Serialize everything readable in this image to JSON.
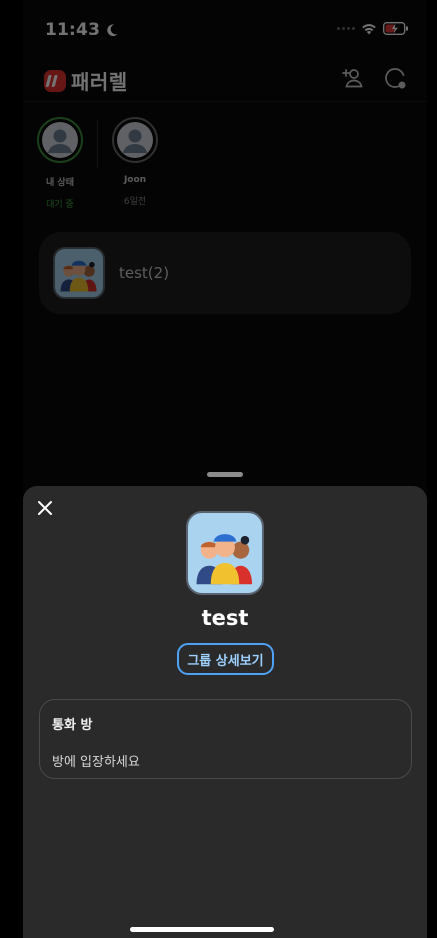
{
  "status_bar": {
    "time": "11:43"
  },
  "app": {
    "name": "패러렐"
  },
  "people": [
    {
      "name": "내 상태",
      "status": "대기 중",
      "active": true
    },
    {
      "name": "Joon",
      "status": "6일전",
      "active": false
    }
  ],
  "groups": [
    {
      "name": "test(2)"
    }
  ],
  "sheet": {
    "title": "test",
    "detail_button": "그룹 상세보기",
    "call_room": {
      "title": "통화 방",
      "description": "방에 입장하세요"
    }
  },
  "colors": {
    "accent_blue": "#4ea1f5",
    "active_green": "#39a839",
    "brand_red": "#e2322d"
  }
}
